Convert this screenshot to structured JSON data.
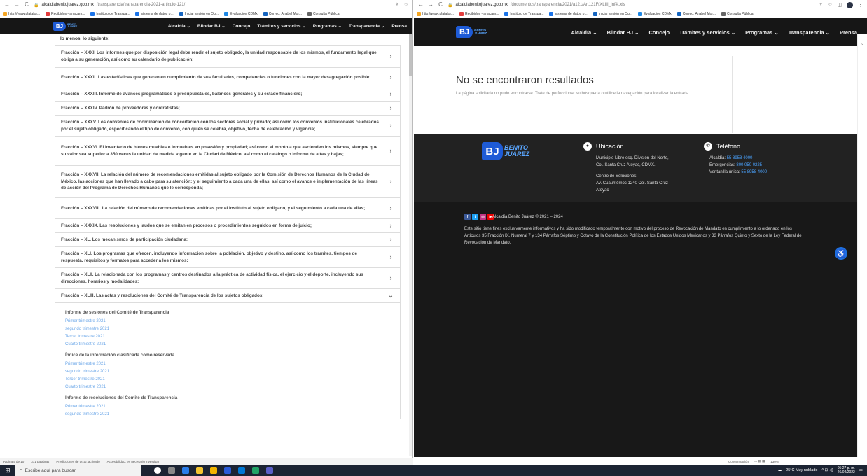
{
  "left_browser": {
    "url_domain": "alcaldiabenitojuarez.gob.mx",
    "url_path": "/transparencia/transparencia-2021-articulo-121/",
    "bookmarks": [
      "http://www.platafor...",
      "Recibidos - anacam...",
      "Instituto de Transpa...",
      "sistema de datos p...",
      "Iniciar sesión en Ou...",
      "Evaluación CDMx",
      "Correo: Anabel Mor...",
      "Consulta Pública"
    ]
  },
  "right_browser": {
    "url_domain": "alcaldiabenitojuarez.gob.mx",
    "url_path": "/documentos/transparencia/2021/a121/Art121FrXLIII_Inf4t.xls",
    "bookmarks": [
      "http://www.platafor...",
      "Recibidos - anacam...",
      "Instituto de Transpa...",
      "sistema de datos p...",
      "Iniciar sesión en Ou...",
      "Evaluación CDMx",
      "Correo: Anabel Mor...",
      "Consulta Pública"
    ]
  },
  "site_nav": {
    "logo_mark": "BJ",
    "logo_text_1": "BENITO",
    "logo_text_2": "JUÁREZ",
    "items": [
      "Alcaldía ⌄",
      "Blindar BJ ⌄",
      "Concejo",
      "Trámites y servicios ⌄",
      "Programas ⌄",
      "Transparencia ⌄",
      "Prensa"
    ]
  },
  "doc": {
    "intro": "lo menos, lo siguiente:",
    "fracciones": [
      {
        "text": "Fracción – XXXI. Los informes que por disposición legal debe rendir el sujeto obligado, la unidad responsable de los mismos, el fundamento legal que obliga a su generación, así como su calendario de publicación;",
        "chev": "›"
      },
      {
        "text": "Fracción – XXXII. Las estadísticas que generen en cumplimiento de sus facultades, competencias o funciones con la mayor desagregación posible;",
        "chev": "›"
      },
      {
        "text": "Fracción – XXXIII. Informe de avances programáticos o presupuestales, balances generales y su estado financiero;",
        "chev": "›"
      },
      {
        "text": "Fracción – XXXIV. Padrón de proveedores y contratistas;",
        "chev": "›"
      },
      {
        "text": "Fracción – XXXV. Los convenios de coordinación de concertación con los sectores social y privado; así como los convenios institucionales celebrados por el sujeto obligado, especificando el tipo de convenio, con quién se celebra, objetivo, fecha de celebración y vigencia;",
        "chev": "›"
      },
      {
        "text": "Fracción – XXXVI. El inventario de bienes muebles e inmuebles en posesión y propiedad; así como el monto a que ascienden los mismos, siempre que su valor sea superior a 350 veces la unidad de medida vigente en la Ciudad de México, así como el catálogo o informe de altas y bajas;",
        "chev": "›"
      },
      {
        "text": "Fracción – XXXVII. La relación del número de recomendaciones emitidas al sujeto obligado por la Comisión de Derechos Humanos de la Ciudad de México, las acciones que han llevado a cabo para su atención; y el seguimiento a cada una de ellas, así como el avance e implementación de las líneas de acción del Programa de Derechos Humanos que le corresponda;",
        "chev": "›"
      },
      {
        "text": "Fracción – XXXVIII. La relación del número de recomendaciones emitidas por el Instituto al sujeto obligado, y el seguimiento a cada una de ellas;",
        "chev": "›"
      },
      {
        "text": "Fracción – XXXIX. Las resoluciones y laudos que se emitan en procesos o procedimientos seguidos en forma de juicio;",
        "chev": "›"
      },
      {
        "text": "Fracción – XL. Los mecanismos de participación ciudadana;",
        "chev": "›"
      },
      {
        "text": "Fracción – XLI. Los programas que ofrecen, incluyendo información sobre la población, objetivo y destino, así como los trámites, tiempos de respuesta, requisitos y formatos para acceder a los mismos;",
        "chev": "›"
      },
      {
        "text": "Fracción – XLII. La relacionada con los programas y centros destinados a la práctica de actividad física, el ejercicio y el deporte, incluyendo sus direcciones, horarios y modalidades;",
        "chev": "›"
      },
      {
        "text": "Fracción – XLIII. Las actas y resoluciones del Comité de Transparencia de los sujetos obligados;",
        "chev": "⌄"
      }
    ],
    "open_section": {
      "groups": [
        {
          "title": "Informe de sesiones del Comité de Transparencia",
          "links": [
            "Primer trimestre 2021",
            "segundo trimestre 2021",
            "Tercer trimestre 2021",
            "Cuarto trimestre 2021"
          ]
        },
        {
          "title": "Índice de la información clasificada como reservada",
          "links": [
            "Primer trimestre 2021",
            "segundo trimestre 2021",
            "Tercer trimestre 2021",
            "Cuarto trimestre 2021"
          ]
        },
        {
          "title": "Informe de resoluciones del Comité de Transparencia",
          "links": [
            "Primer trimestre 2021",
            "segundo trimestre 2021"
          ]
        }
      ]
    }
  },
  "not_found": {
    "title": "No se encontraron resultados",
    "text": "La página solicitada no pudo encontrarse. Trate de perfeccionar su búsqueda o utilice la navegación para localizar la entrada."
  },
  "footer": {
    "ubicacion_title": "Ubicación",
    "ubicacion_lines": [
      "Municipio Libre esq. División del Norte,",
      "Col. Santa Cruz Atoyac, CDMX."
    ],
    "centro_lines": [
      "Centro de Soluciones:",
      "Av. Cuauhtémoc 1240 Col. Santa Cruz",
      "Atoyac"
    ],
    "telefono_title": "Teléfono",
    "telefonos": [
      {
        "label": "Alcaldía:",
        "value": "55 8958 4000"
      },
      {
        "label": "Emergencias:",
        "value": "800 050 0225"
      },
      {
        "label": "Ventanilla única:",
        "value": "55 8958 4000"
      }
    ],
    "copyright": "Alcaldía Benito Juárez © 2021 – 2024",
    "disclaimer": "Este sitio tiene fines exclusivamente informativos y ha sido modificado temporalmente con motivo del proceso de Revocación de Mandato en cumplimiento a lo ordenado en los Artículos 35 Fracción IX, Numeral 7 y 134 Párrafos Séptimo y Octavo de la Constitución Política de los Estados Unidos Mexicanos y 33 Párrafos Quinto y Sexto de la Ley Federal de Revocación de Mandato."
  },
  "word_status": {
    "page": "Página 5 de 10",
    "words": "371 palabras",
    "predictions": "Predicciones de texto: activado",
    "accessibility": "Accesibilidad: es necesario investigar"
  },
  "right_status": {
    "focus": "Concentración",
    "zoom": "130%"
  },
  "taskbar": {
    "search_placeholder": "Escribe aquí para buscar",
    "weather": "25°C Muy nublado",
    "time": "05:27 p. m.",
    "date": "26/04/2022"
  },
  "colors": {
    "nav_bg": "#161616",
    "link_blue": "#6aa6e8",
    "footer_blue": "#4aa3ff",
    "brand_blue": "#1e5bd6"
  }
}
